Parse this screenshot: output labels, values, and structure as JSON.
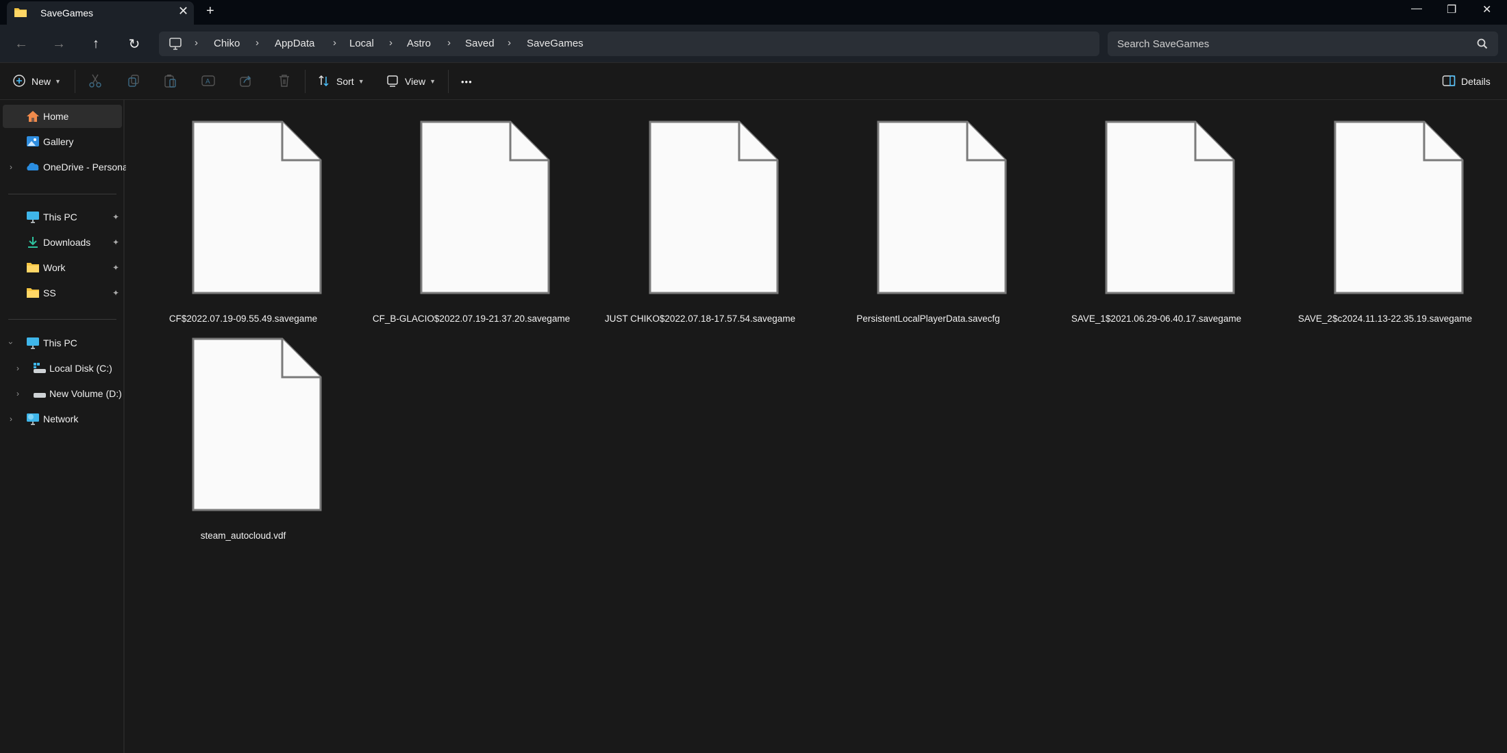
{
  "window": {
    "tab_title": "SaveGames",
    "tab_icon": "folder-icon",
    "new_tab_symbol": "+",
    "close_tab_symbol": "✕",
    "controls": {
      "minimize": "—",
      "maximize": "❐",
      "close": "✕"
    }
  },
  "nav": {
    "back": "←",
    "forward": "→",
    "up": "↑",
    "refresh": "↻",
    "breadcrumb": [
      "Chiko",
      "AppData",
      "Local",
      "Astro",
      "Saved",
      "SaveGames"
    ],
    "separator": "›",
    "search_placeholder": "Search SaveGames",
    "search_value": ""
  },
  "toolbar": {
    "new_label": "New",
    "sort_label": "Sort",
    "view_label": "View",
    "more_label": "•••",
    "details_label": "Details",
    "accent": "#4cc2ff"
  },
  "sidebar": {
    "top_items": [
      {
        "label": "Home",
        "icon": "home-icon",
        "active": true
      },
      {
        "label": "Gallery",
        "icon": "gallery-icon"
      },
      {
        "label": "OneDrive - Persona",
        "icon": "onedrive-icon",
        "expandable": true
      }
    ],
    "pinned": [
      {
        "label": "This PC",
        "icon": "monitor-icon"
      },
      {
        "label": "Downloads",
        "icon": "download-icon"
      },
      {
        "label": "Work",
        "icon": "folder-icon"
      },
      {
        "label": "SS",
        "icon": "folder-icon"
      }
    ],
    "tree": [
      {
        "label": "This PC",
        "icon": "monitor-icon",
        "expanded": true
      },
      {
        "label": "Local Disk (C:)",
        "icon": "drive-icon",
        "child": true
      },
      {
        "label": "New Volume (D:)",
        "icon": "drive-icon",
        "child": true
      },
      {
        "label": "Network",
        "icon": "network-icon"
      }
    ],
    "pin_symbol": "📌"
  },
  "files": [
    {
      "name": "CF$2022.07.19-09.55.49.savegame"
    },
    {
      "name": "CF_B-GLACIO$2022.07.19-21.37.20.savegame"
    },
    {
      "name": "JUST CHIKO$2022.07.18-17.57.54.savegame"
    },
    {
      "name": "PersistentLocalPlayerData.savecfg"
    },
    {
      "name": "SAVE_1$2021.06.29-06.40.17.savegame"
    },
    {
      "name": "SAVE_2$c2024.11.13-22.35.19.savegame"
    },
    {
      "name": "steam_autocloud.vdf"
    }
  ]
}
